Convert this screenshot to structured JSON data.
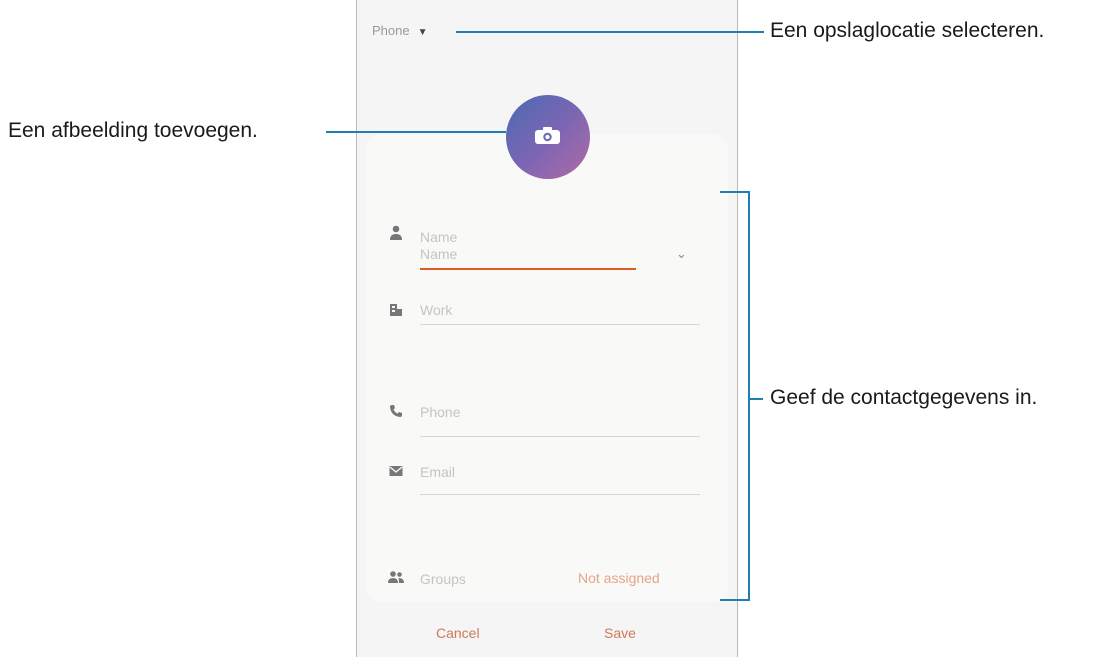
{
  "phone": {
    "storage_label": "Phone",
    "fields": {
      "name_header": "Name",
      "name_input": "Name",
      "organization": "Work",
      "phone": "Phone",
      "email": "Email",
      "groups": "Groups",
      "groups_value": "Not assigned"
    },
    "buttons": {
      "cancel": "Cancel",
      "save": "Save"
    }
  },
  "annotations": {
    "storage": "Een opslaglocatie selecteren.",
    "picture": "Een afbeelding toevoegen.",
    "details": "Geef de contactgegevens in."
  },
  "colors": {
    "accent": "#e05a28",
    "callout": "#1f7fb3"
  }
}
